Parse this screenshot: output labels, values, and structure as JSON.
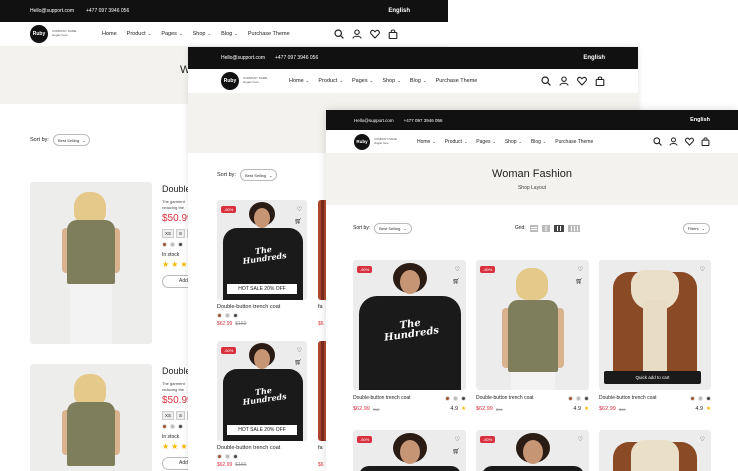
{
  "topbar": {
    "email": "Hello@support.com",
    "phone": "+477 097 3946 056",
    "language": "English"
  },
  "brand": {
    "logo": "Ruby",
    "line1": "COMPANY NAME",
    "line2": "slogan here"
  },
  "menu": [
    {
      "label": "Home"
    },
    {
      "label": "Product"
    },
    {
      "label": "Pages"
    },
    {
      "label": "Shop"
    },
    {
      "label": "Blog"
    },
    {
      "label": "Purchase Theme"
    }
  ],
  "icons": [
    "search-icon",
    "user-icon",
    "heart-icon",
    "bag-icon"
  ],
  "hero": {
    "title": "Woman Fashion",
    "breadcrumb": "Shop Layout",
    "back_title_fragment": "W"
  },
  "toolbar": {
    "sort_label": "Sort by:",
    "sort_value": "Best Selling",
    "grid_label": "Grid:",
    "filter_label": "Filters"
  },
  "list_products": [
    {
      "name": "Double",
      "desc_line1": "The garment",
      "desc_line2": "reducing the",
      "price": "$50.99",
      "sizes": [
        "XS",
        "S",
        "M"
      ],
      "stock": "In stock",
      "add_button": "Add"
    },
    {
      "name": "Double",
      "desc_line1": "The garment",
      "desc_line2": "reducing the",
      "price": "$50.99",
      "sizes": [
        "XS",
        "S",
        "M"
      ],
      "stock": "In stock",
      "add_button": "Add"
    }
  ],
  "mid_products": [
    {
      "badge": "-50%",
      "sale": "HOT SALE 20% OFF",
      "name": "Double-button trench coat",
      "price": "$62.99",
      "old_price": "$160",
      "print": "The Hundreds"
    },
    {
      "badge": "-50%",
      "sale": "HOT SALE 20% OFF",
      "name": "Double-button trench coat",
      "price": "$62.99",
      "old_price": "$160",
      "print": "The Hundreds"
    }
  ],
  "mid_peek": {
    "name": "fa",
    "price": "$6"
  },
  "front_products": [
    {
      "badge": "-50%",
      "name": "Double-button trench coat",
      "price": "$62.99",
      "old_price": "$98",
      "rating": "4.9",
      "print": "The Hundreds"
    },
    {
      "badge": "-50%",
      "name": "Double-button trench coat",
      "price": "$62.99",
      "old_price": "$98",
      "rating": "4.9"
    },
    {
      "name": "Double-button trench coat",
      "price": "$62.99",
      "old_price": "$98",
      "rating": "4.9",
      "quick_add": "Quick add to cart"
    }
  ],
  "row2_badges": [
    "-50%",
    "-50%"
  ],
  "colors": {
    "accent": "#d9303e",
    "dark": "#111111",
    "hero_bg": "#f4f2ee",
    "star": "#f5b800"
  }
}
